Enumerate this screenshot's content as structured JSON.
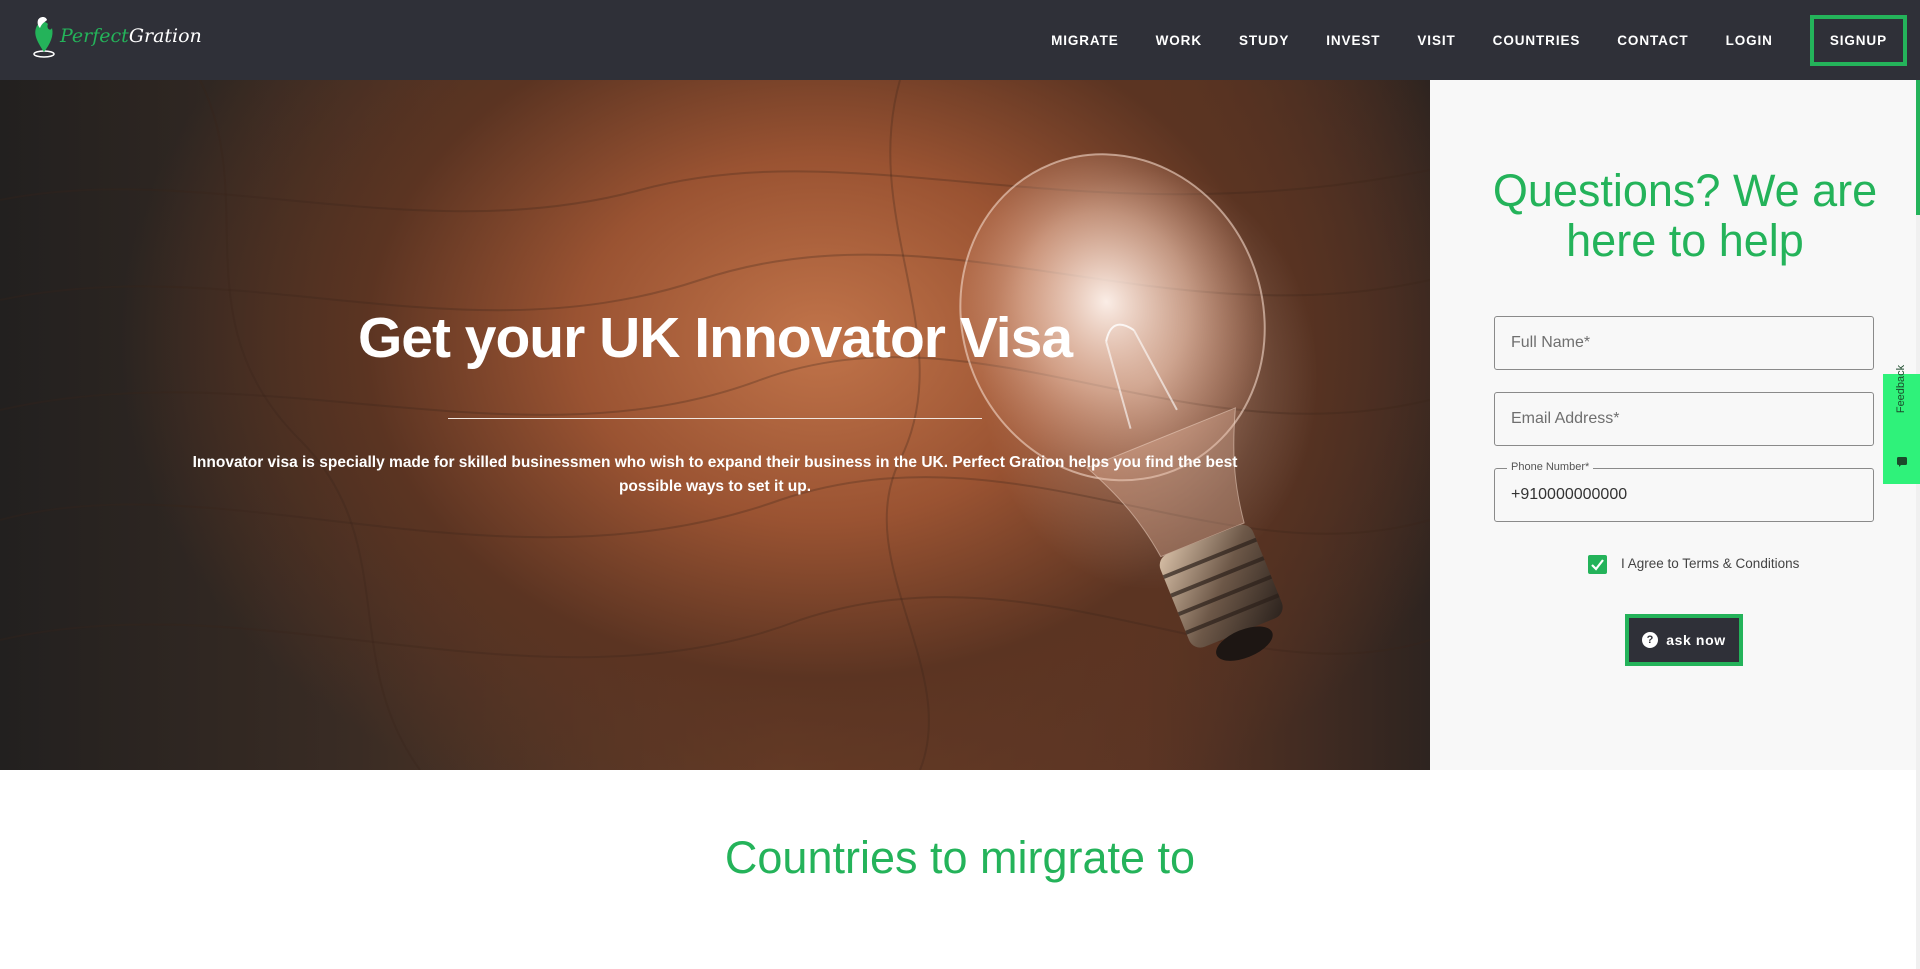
{
  "brand": {
    "name_part1": "Perfect",
    "name_part2": "Gration"
  },
  "nav": {
    "items": [
      "MIGRATE",
      "WORK",
      "STUDY",
      "INVEST",
      "VISIT",
      "COUNTRIES",
      "CONTACT",
      "LOGIN"
    ],
    "signup": "SIGNUP"
  },
  "hero": {
    "title": "Get your UK Innovator Visa",
    "subtitle": "Innovator visa is specially made for skilled businessmen who wish to expand their business in the UK. Perfect Gration helps you find the best possible ways to set it up."
  },
  "form": {
    "title": "Questions? We are here to help",
    "full_name_placeholder": "Full Name*",
    "email_placeholder": "Email Address*",
    "phone_label": "Phone Number*",
    "phone_value": "+910000000000",
    "terms_label": "I Agree to Terms & Conditions",
    "terms_checked": true,
    "submit_label": "ask now"
  },
  "feedback_tab": "Feedback",
  "countries_section": {
    "title": "Countries to mirgrate to"
  },
  "colors": {
    "accent": "#24b35a",
    "nav_bg": "#2f3038",
    "panel_bg": "#f8f8f8",
    "feedback_bg": "#2ff27a"
  },
  "icons": [
    "logo-pin-icon",
    "question-icon",
    "check-icon",
    "chat-icon",
    "lightbulb-image"
  ]
}
